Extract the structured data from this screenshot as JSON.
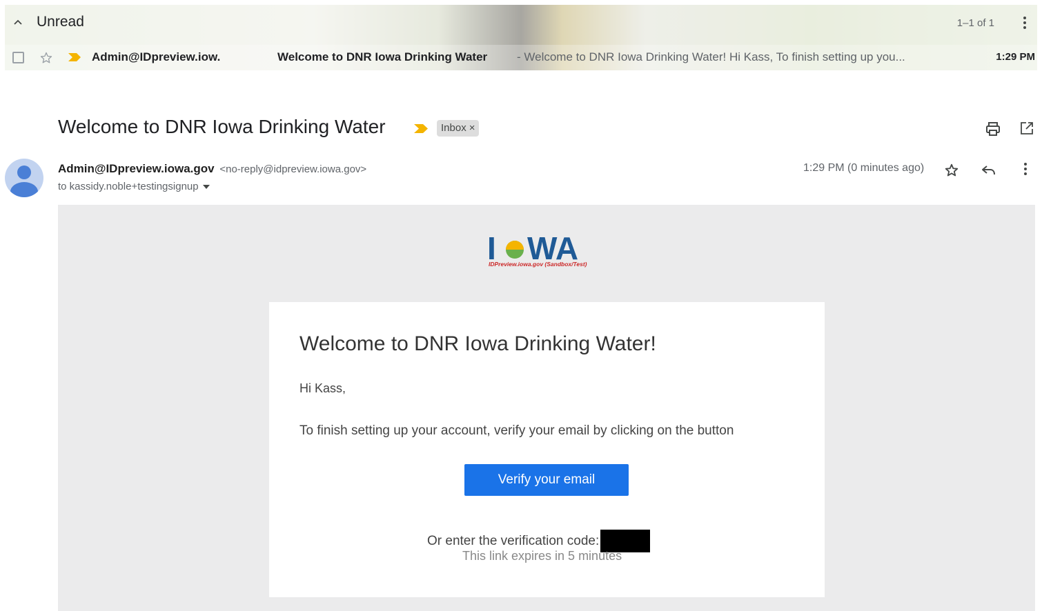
{
  "list": {
    "section_title": "Unread",
    "count": "1–1 of 1",
    "row": {
      "sender": "Admin@IDpreview.iow.",
      "subject": "Welcome to DNR Iowa Drinking Water",
      "snippet": " - Welcome to DNR Iowa Drinking Water! Hi Kass, To finish setting up you...",
      "time": "1:29 PM"
    }
  },
  "message": {
    "subject": "Welcome to DNR Iowa Drinking Water",
    "label": "Inbox",
    "label_remove": "×",
    "from_name": "Admin@IDpreview.iowa.gov",
    "from_email": "<no-reply@idpreview.iowa.gov>",
    "to": "to kassidy.noble+testingsignup",
    "time": "1:29 PM (0 minutes ago)"
  },
  "email": {
    "logo_text": "IOWA",
    "logo_subtitle": "IDPreview.iowa.gov (Sandbox/Test)",
    "title": "Welcome to DNR Iowa Drinking Water!",
    "greeting": "Hi Kass,",
    "instructions": "To finish setting up your account, verify your email by clicking on the button",
    "button": "Verify your email",
    "code_label": "Or enter the verification code:",
    "expires": "This link expires in 5 minutes"
  },
  "colors": {
    "button": "#1a73e8",
    "important_marker": "#f4b400",
    "logo_blue": "#1f5a96",
    "logo_green": "#6ab04c",
    "logo_red": "#cc2929"
  },
  "icons": [
    "chevron-up-icon",
    "more-vert-icon",
    "checkbox-icon",
    "star-icon",
    "important-marker-icon",
    "print-icon",
    "open-in-new-icon",
    "avatar-icon",
    "caret-down-icon",
    "reply-icon"
  ]
}
